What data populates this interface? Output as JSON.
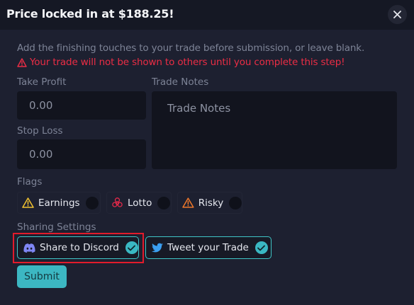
{
  "header": {
    "title": "Price locked in at $188.25!"
  },
  "intro": {
    "description": "Add the finishing touches to your trade before submission, or leave blank.",
    "warning": "Your trade will not be shown to others until you complete this step!"
  },
  "fields": {
    "take_profit_label": "Take Profit",
    "take_profit_placeholder": "0.00",
    "stop_loss_label": "Stop Loss",
    "stop_loss_placeholder": "0.00",
    "trade_notes_label": "Trade Notes",
    "trade_notes_placeholder": "Trade Notes"
  },
  "flags": {
    "label": "Flags",
    "items": [
      {
        "label": "Earnings",
        "icon": "warning-triangle-icon",
        "color": "#f2c230"
      },
      {
        "label": "Lotto",
        "icon": "biohazard-icon",
        "color": "#e5294a"
      },
      {
        "label": "Risky",
        "icon": "warning-triangle-icon",
        "color": "#f0782a"
      }
    ]
  },
  "sharing": {
    "label": "Sharing Settings",
    "discord_label": "Share to Discord",
    "twitter_label": "Tweet your Trade",
    "discord_color": "#7f87f5",
    "twitter_color": "#3b9ff0",
    "accent": "#3fc6c7"
  },
  "actions": {
    "submit_label": "Submit"
  }
}
